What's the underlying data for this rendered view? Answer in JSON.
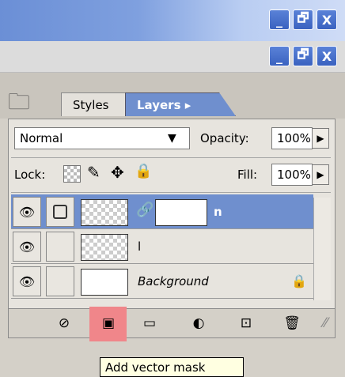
{
  "window": {
    "minimize_glyph": "_",
    "restore_glyph": "🗗",
    "close_glyph": "X"
  },
  "tabs": {
    "styles": "Styles",
    "layers": "Layers ▸"
  },
  "blend": {
    "mode": "Normal",
    "opacity_label": "Opacity:",
    "opacity_value": "100%"
  },
  "lock": {
    "label": "Lock:",
    "fill_label": "Fill:",
    "fill_value": "100%"
  },
  "layers": [
    {
      "name": "n",
      "selected": true
    },
    {
      "name": "l",
      "selected": false
    },
    {
      "name": "Background",
      "selected": false,
      "locked": true
    }
  ],
  "bottom_icons": [
    "link-layers-icon",
    "add-vector-mask-icon",
    "new-group-icon",
    "adjustment-layer-icon",
    "new-layer-icon",
    "trash-icon"
  ],
  "tooltip": "Add vector mask",
  "colors": {
    "selected_row": "#6f8fce",
    "highlight": "#f0868a",
    "title_blue": "#6b8fd6"
  }
}
